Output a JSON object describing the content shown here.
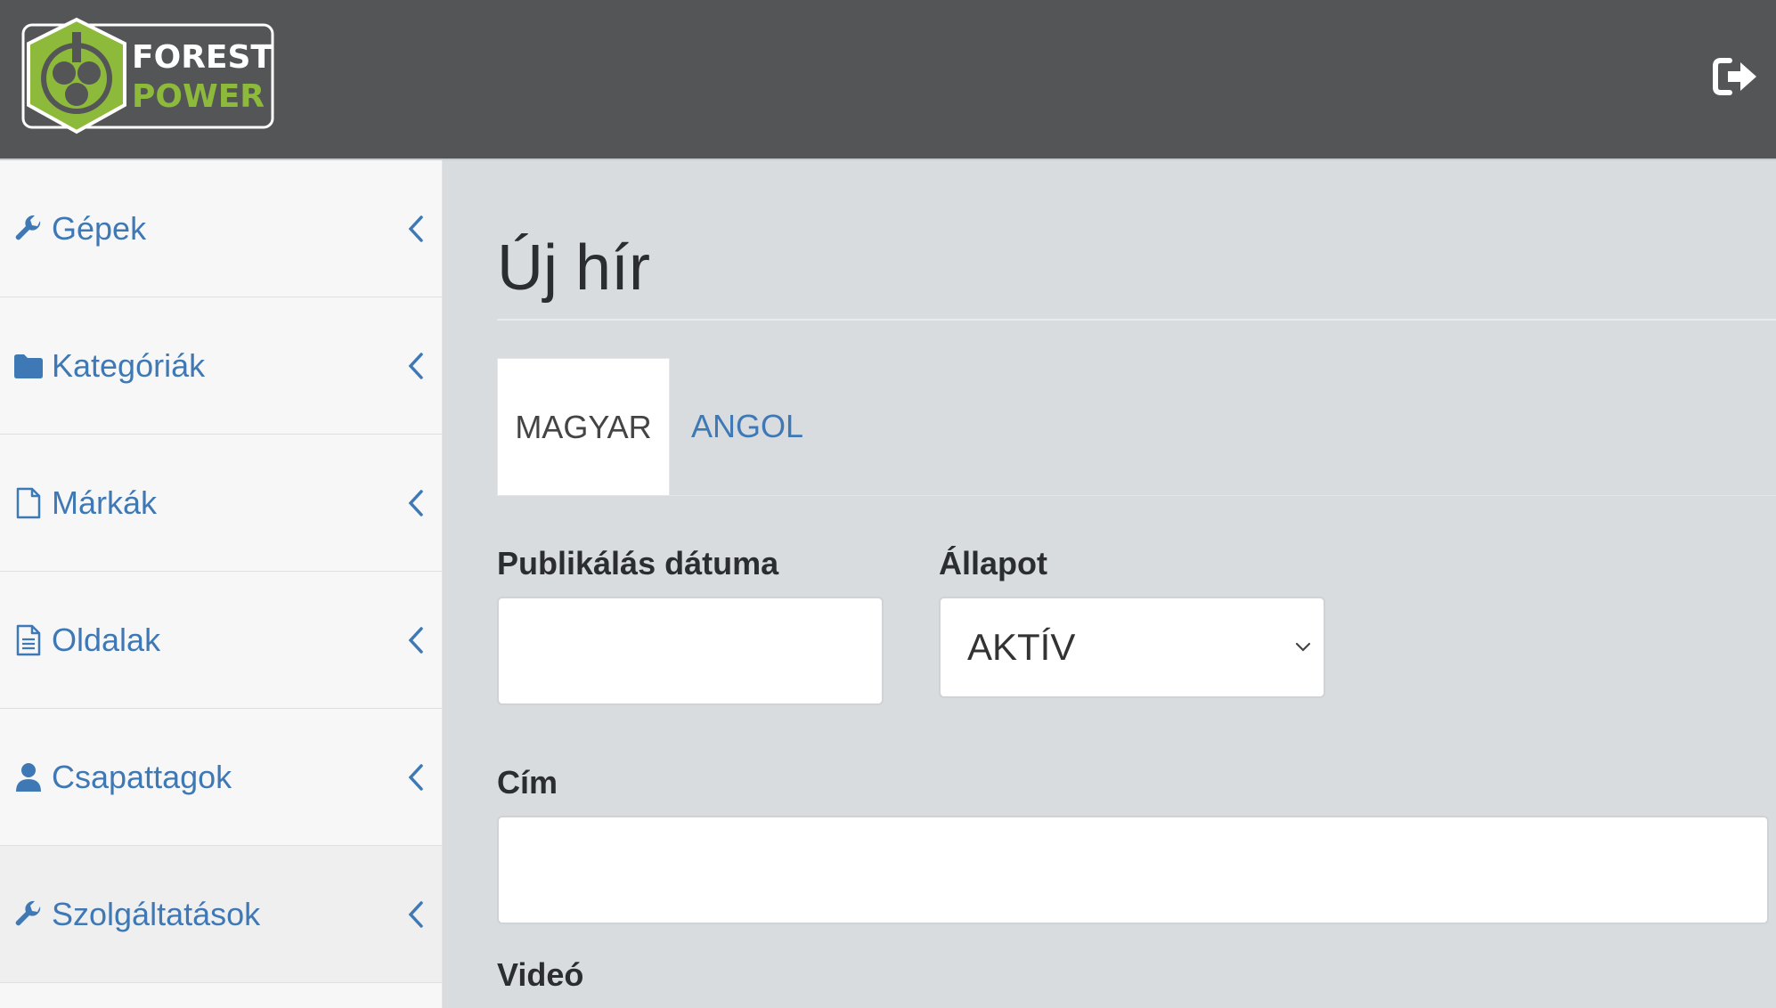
{
  "brand": {
    "line1": "FOREST",
    "line2": "POWER"
  },
  "colors": {
    "header_bg": "#545557",
    "accent_blue": "#3f79b5",
    "logo_green": "#8dba3b"
  },
  "sidebar": {
    "items": [
      {
        "label": "Gépek",
        "icon": "wrench-icon"
      },
      {
        "label": "Kategóriák",
        "icon": "folder-icon"
      },
      {
        "label": "Márkák",
        "icon": "file-icon"
      },
      {
        "label": "Oldalak",
        "icon": "file-text-icon"
      },
      {
        "label": "Csapattagok",
        "icon": "user-icon"
      },
      {
        "label": "Szolgáltatások",
        "icon": "wrench-icon"
      }
    ]
  },
  "page": {
    "title": "Új hír"
  },
  "tabs": [
    {
      "label": "MAGYAR"
    },
    {
      "label": "ANGOL"
    }
  ],
  "form": {
    "publish_date": {
      "label": "Publikálás dátuma",
      "value": "",
      "placeholder": ""
    },
    "status": {
      "label": "Állapot",
      "selected": "AKTÍV"
    },
    "title": {
      "label": "Cím",
      "value": "",
      "placeholder": ""
    },
    "video": {
      "label": "Videó"
    }
  }
}
